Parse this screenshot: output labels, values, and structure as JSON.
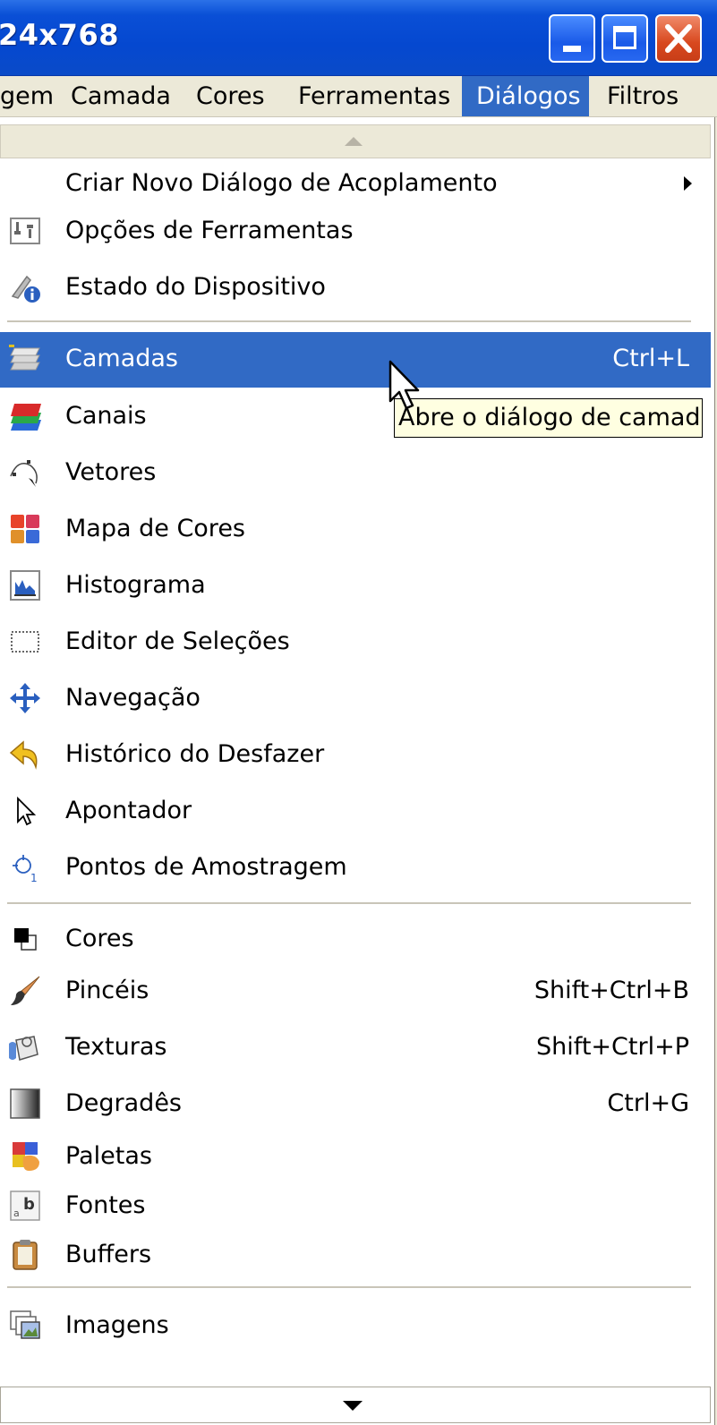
{
  "window": {
    "title": "24x768"
  },
  "menubar": {
    "items": [
      "gem",
      "Camada",
      "Cores",
      "Ferramentas",
      "Diálogos",
      "Filtros"
    ],
    "active": "Diálogos"
  },
  "menu": {
    "items": [
      {
        "label": "Criar Novo Diálogo de Acoplamento",
        "shortcut": "",
        "icon": "none",
        "submenu": true
      },
      {
        "label": "Opções de Ferramentas",
        "shortcut": "",
        "icon": "tool-options-icon"
      },
      {
        "label": "Estado do Dispositivo",
        "shortcut": "",
        "icon": "device-status-icon"
      },
      {
        "label": "Camadas",
        "shortcut": "Ctrl+L",
        "icon": "layers-icon",
        "highlighted": true
      },
      {
        "label": "Canais",
        "shortcut": "",
        "icon": "channels-icon"
      },
      {
        "label": "Vetores",
        "shortcut": "",
        "icon": "paths-icon"
      },
      {
        "label": "Mapa de Cores",
        "shortcut": "",
        "icon": "colormap-icon"
      },
      {
        "label": "Histograma",
        "shortcut": "",
        "icon": "histogram-icon"
      },
      {
        "label": "Editor de Seleções",
        "shortcut": "",
        "icon": "selection-editor-icon"
      },
      {
        "label": "Navegação",
        "shortcut": "",
        "icon": "navigation-icon"
      },
      {
        "label": "Histórico do Desfazer",
        "shortcut": "",
        "icon": "undo-history-icon"
      },
      {
        "label": "Apontador",
        "shortcut": "",
        "icon": "pointer-icon"
      },
      {
        "label": "Pontos de Amostragem",
        "shortcut": "",
        "icon": "sample-points-icon"
      },
      {
        "label": "Cores",
        "shortcut": "",
        "icon": "colors-icon"
      },
      {
        "label": "Pincéis",
        "shortcut": "Shift+Ctrl+B",
        "icon": "brushes-icon"
      },
      {
        "label": "Texturas",
        "shortcut": "Shift+Ctrl+P",
        "icon": "patterns-icon"
      },
      {
        "label": "Degradês",
        "shortcut": "Ctrl+G",
        "icon": "gradients-icon"
      },
      {
        "label": "Paletas",
        "shortcut": "",
        "icon": "palettes-icon"
      },
      {
        "label": "Fontes",
        "shortcut": "",
        "icon": "fonts-icon"
      },
      {
        "label": "Buffers",
        "shortcut": "",
        "icon": "buffers-icon"
      },
      {
        "label": "Imagens",
        "shortcut": "",
        "icon": "images-icon"
      }
    ]
  },
  "tooltip": {
    "text": "Abre o diálogo de camadas"
  },
  "colors": {
    "highlight": "#316ac5",
    "tooltip_bg": "#ffffe1",
    "menu_bg": "#ece9d8"
  }
}
